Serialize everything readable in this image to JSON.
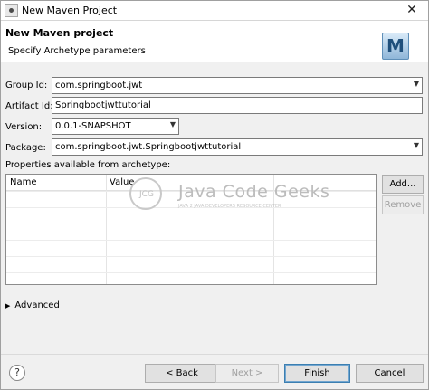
{
  "window": {
    "title": "New Maven Project",
    "close_glyph": "✕"
  },
  "banner": {
    "title": "New Maven project",
    "subtitle": "Specify Archetype parameters",
    "logo_letter": "M",
    "logo_icon": "maven-wizard-icon"
  },
  "form": {
    "group_id": {
      "label": "Group Id:",
      "value": "com.springboot.jwt"
    },
    "artifact_id": {
      "label": "Artifact Id:",
      "value": "Springbootjwttutorial"
    },
    "version": {
      "label": "Version:",
      "value": "0.0.1-SNAPSHOT"
    },
    "package": {
      "label": "Package:",
      "value": "com.springboot.jwt.Springbootjwttutorial"
    }
  },
  "properties": {
    "label": "Properties available from archetype:",
    "columns": [
      "Name",
      "Value"
    ],
    "rows": []
  },
  "watermark": {
    "logo_text": "JCG",
    "name": "Java Code Geeks",
    "tagline": "JAVA 2 JAVA DEVELOPERS RESOURCE CENTER"
  },
  "side_buttons": {
    "add": "Add...",
    "remove": "Remove"
  },
  "advanced": {
    "arrow": "▶",
    "label": "Advanced"
  },
  "footer": {
    "help": "?",
    "back": "< Back",
    "next": "Next >",
    "finish": "Finish",
    "cancel": "Cancel"
  },
  "icons": {
    "dropdown": "▼",
    "help": "help-icon",
    "close": "close-icon"
  }
}
